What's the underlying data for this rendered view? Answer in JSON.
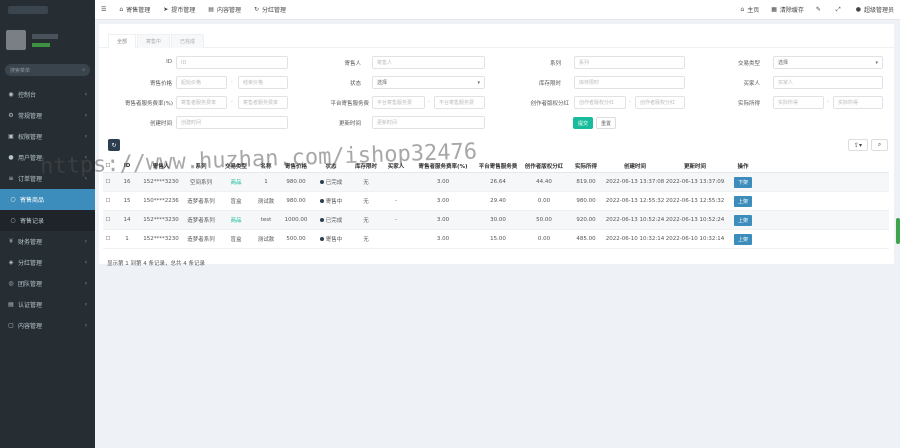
{
  "sidebar": {
    "search_placeholder": "搜索菜单",
    "items": [
      {
        "label": "控制台",
        "icon": "dashboard-icon",
        "active": false
      },
      {
        "label": "常规管理",
        "icon": "gear-icon",
        "active": false
      },
      {
        "label": "权限管理",
        "icon": "group-icon",
        "active": false
      },
      {
        "label": "用户管理",
        "icon": "user-icon",
        "active": false
      },
      {
        "label": "订单管理",
        "icon": "list-icon",
        "active": false
      },
      {
        "label": "寄售商品",
        "icon": "circle-icon",
        "active": true,
        "sub": true
      },
      {
        "label": "寄售记录",
        "icon": "circle-icon",
        "active": false,
        "sub": true
      },
      {
        "label": "财务管理",
        "icon": "money-icon",
        "active": false
      },
      {
        "label": "分红管理",
        "icon": "gift-icon",
        "active": false
      },
      {
        "label": "团队管理",
        "icon": "team-icon",
        "active": false
      },
      {
        "label": "认证管理",
        "icon": "idcard-icon",
        "active": false
      },
      {
        "label": "内容管理",
        "icon": "file-icon",
        "active": false
      }
    ]
  },
  "topbar": {
    "left": [
      {
        "label": "寄售管理",
        "icon": "home-icon"
      },
      {
        "label": "提币管理",
        "icon": "send-icon"
      },
      {
        "label": "内容管理",
        "icon": "book-icon"
      },
      {
        "label": "分红管理",
        "icon": "refresh-icon"
      }
    ],
    "right": [
      {
        "label": "主页",
        "icon": "home-icon"
      },
      {
        "label": "清除缓存",
        "icon": "trash-icon"
      },
      {
        "label": "",
        "icon": "bell-icon"
      },
      {
        "label": "",
        "icon": "fullscreen-icon"
      },
      {
        "label": "超级管理员",
        "icon": "user-icon"
      }
    ]
  },
  "tabs": [
    "全部",
    "寄售中",
    "已完成"
  ],
  "filters": {
    "id": {
      "label": "ID",
      "placeholder": "ID"
    },
    "seller": {
      "label": "寄售人",
      "placeholder": "寄售人"
    },
    "series": {
      "label": "系列",
      "placeholder": "系列"
    },
    "trade_type": {
      "label": "交易类型",
      "value": "选择"
    },
    "price": {
      "label": "寄售价格",
      "placeholder_min": "起始价格",
      "placeholder_max": "结束价格"
    },
    "status": {
      "label": "状态",
      "value": "选择"
    },
    "limit": {
      "label": "库存限时",
      "placeholder": "库存限时"
    },
    "buyer": {
      "label": "买家人",
      "placeholder": "买家人"
    },
    "owner_fee": {
      "label": "寄售者服务费率(%)",
      "placeholder_min": "寄售者服务费率",
      "placeholder_max": "寄售者服务费率"
    },
    "platform_fee": {
      "label": "平台寄售服务费",
      "placeholder_min": "平台寄售服务费",
      "placeholder_max": "平台寄售服务费"
    },
    "creator_share": {
      "label": "创作者版权分红",
      "placeholder_min": "创作者版权分红",
      "placeholder_max": "创作者版权分红"
    },
    "actual_income": {
      "label": "实际所得",
      "placeholder_min": "实际所得",
      "placeholder_max": "实际所得"
    },
    "create_time": {
      "label": "创建时间",
      "placeholder": "创建时间"
    },
    "update_time": {
      "label": "更新时间",
      "placeholder": "更新时间"
    },
    "submit_label": "提交",
    "reset_label": "重置"
  },
  "table": {
    "columns": [
      "",
      "ID",
      "寄售人",
      "系列",
      "交易类型",
      "名称",
      "寄售价格",
      "状态",
      "库存限时",
      "买家人",
      "寄售者服务费率(%)",
      "平台寄售服务费",
      "创作者版权分红",
      "实际所得",
      "创建时间",
      "更新时间",
      "操作"
    ],
    "rows": [
      {
        "id": "16",
        "seller": "152****3230",
        "series": "空间系列",
        "type": "商品",
        "name": "1",
        "price": "980.00",
        "status": "已完成",
        "limit": "无",
        "buyer": "",
        "fee_rate": "3.00",
        "platform": "26.64",
        "creator": "44.40",
        "income": "819.00",
        "created": "2022-06-13 13:37:08",
        "updated": "2022-06-13 13:37:09",
        "op": "下架"
      },
      {
        "id": "15",
        "seller": "150****2236",
        "series": "造梦者系列",
        "type": "盲盒",
        "name": "测试款",
        "price": "980.00",
        "status": "寄售中",
        "limit": "无",
        "buyer": "-",
        "fee_rate": "3.00",
        "platform": "29.40",
        "creator": "0.00",
        "income": "980.00",
        "created": "2022-06-13 12:55:32",
        "updated": "2022-06-13 12:55:32",
        "op": "上架"
      },
      {
        "id": "14",
        "seller": "152****3230",
        "series": "造梦者系列",
        "type": "商品",
        "name": "test",
        "price": "1000.00",
        "status": "已完成",
        "limit": "无",
        "buyer": "-",
        "fee_rate": "3.00",
        "platform": "30.00",
        "creator": "50.00",
        "income": "920.00",
        "created": "2022-06-13 10:52:24",
        "updated": "2022-06-13 10:52:24",
        "op": "上架"
      },
      {
        "id": "1",
        "seller": "152****3230",
        "series": "造梦者系列",
        "type": "盲盒",
        "name": "测试款",
        "price": "500.00",
        "status": "寄售中",
        "limit": "无",
        "buyer": "",
        "fee_rate": "3.00",
        "platform": "15.00",
        "creator": "0.00",
        "income": "485.00",
        "created": "2022-06-10 10:32:14",
        "updated": "2022-06-10 10:32:14",
        "op": "上架"
      }
    ],
    "footer": "显示第 1 到第 4 条记录，总共 4 条记录"
  },
  "watermark": "https://www.huzhan.com/ishop32476"
}
